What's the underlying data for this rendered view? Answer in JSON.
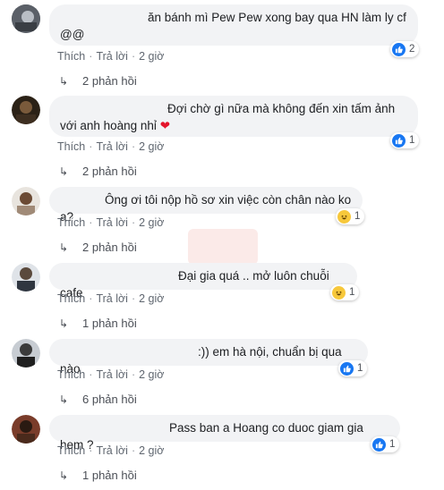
{
  "comments": [
    {
      "text": "ăn bánh mì Pew Pew xong bay qua HN làm ly cf @@",
      "like_label": "Thích",
      "reply_label": "Trả lời",
      "time": "2 giờ",
      "reaction_type": "like",
      "reaction_count": "2",
      "replies": "2 phản hồi"
    },
    {
      "text": "Đợi chờ gì nữa mà không đến xin tấm ảnh với anh hoàng nhỉ",
      "like_label": "Thích",
      "reply_label": "Trả lời",
      "time": "2 giờ",
      "reaction_type": "like",
      "reaction_count": "1",
      "replies": "2 phản hồi"
    },
    {
      "text": "Ông ơi tôi nộp hồ sơ xin việc còn chân nào ko a?",
      "like_label": "Thích",
      "reply_label": "Trả lời",
      "time": "2 giờ",
      "reaction_type": "haha",
      "reaction_count": "1",
      "replies": "2 phản hồi"
    },
    {
      "text": "Đại gia quá .. mở luôn chuỗi cafe",
      "like_label": "Thích",
      "reply_label": "Trả lời",
      "time": "2 giờ",
      "reaction_type": "haha",
      "reaction_count": "1",
      "replies": "1 phản hồi"
    },
    {
      "text": ":)) em hà nội, chuẩn bị qua nào",
      "like_label": "Thích",
      "reply_label": "Trả lời",
      "time": "2 giờ",
      "reaction_type": "like",
      "reaction_count": "1",
      "replies": "6 phản hồi"
    },
    {
      "text": "Pass ban a Hoang co duoc giam gia hem ?",
      "like_label": "Thích",
      "reply_label": "Trả lời",
      "time": "2 giờ",
      "reaction_type": "like",
      "reaction_count": "1",
      "replies": "1 phản hồi"
    }
  ],
  "colors": {
    "bubble": "#f2f3f5",
    "like": "#1877f2",
    "haha": "#f7c83b",
    "heart": "#e4152c",
    "meta_text": "#606770"
  }
}
